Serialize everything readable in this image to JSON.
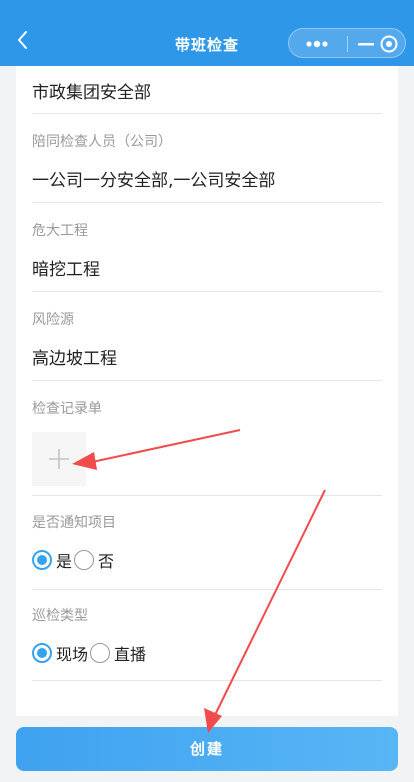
{
  "header": {
    "title": "带班检查"
  },
  "form": {
    "org_value": "市政集团安全部",
    "accompany": {
      "label": "陪同检查人员（公司）",
      "value": "一公司一分安全部,一公司安全部"
    },
    "project": {
      "label": "危大工程",
      "value": "暗挖工程"
    },
    "risk": {
      "label": "风险源",
      "value": "高边坡工程"
    },
    "record": {
      "label": "检查记录单"
    },
    "notify": {
      "label": "是否通知项目",
      "options": [
        "是",
        "否"
      ],
      "selected": "是"
    },
    "inspection_type": {
      "label": "巡检类型",
      "options": [
        "现场",
        "直播"
      ],
      "selected": "现场"
    }
  },
  "actions": {
    "create_label": "创建"
  },
  "colors": {
    "topbar": "#2f97e8",
    "accent": "#35a3ee",
    "annotation_arrow": "#f24b4b"
  }
}
